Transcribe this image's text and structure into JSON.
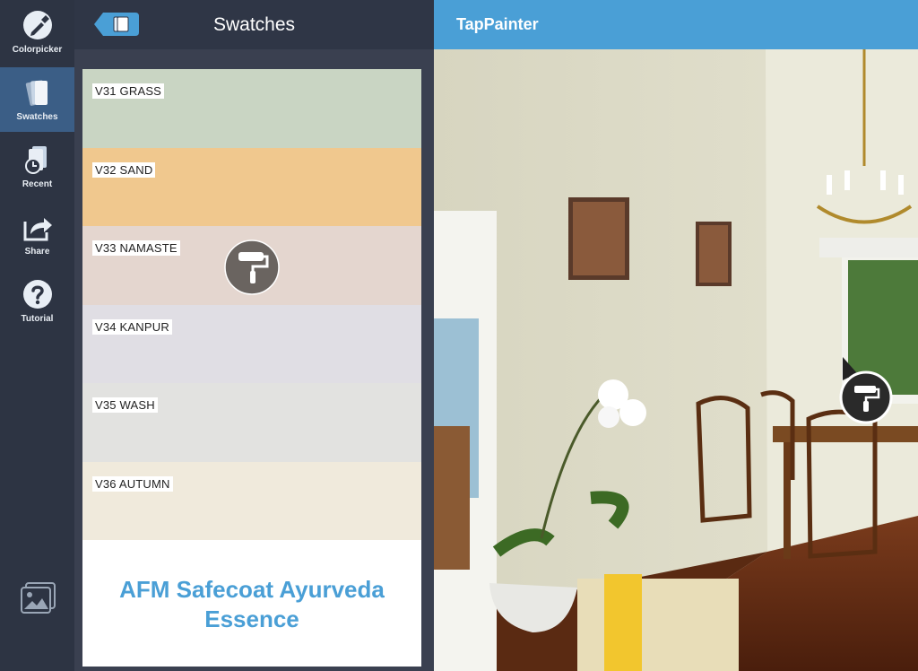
{
  "nav": {
    "items": [
      {
        "label": "Colorpicker",
        "icon": "eyedropper-icon"
      },
      {
        "label": "Swatches",
        "icon": "swatches-icon",
        "active": true
      },
      {
        "label": "Recent",
        "icon": "recent-icon"
      },
      {
        "label": "Share",
        "icon": "share-icon"
      },
      {
        "label": "Tutorial",
        "icon": "help-icon"
      }
    ],
    "gallery_icon": "gallery-icon"
  },
  "swatches_panel": {
    "title": "Swatches",
    "back_icon": "back-icon",
    "swatches": [
      {
        "label": "V31 GRASS",
        "color": "#c9d5c3"
      },
      {
        "label": "V32 SAND",
        "color": "#f0c88e"
      },
      {
        "label": "V33 NAMASTE",
        "color": "#e4d6cf"
      },
      {
        "label": "V34 KANPUR",
        "color": "#e0dee4"
      },
      {
        "label": "V35 WASH",
        "color": "#e2e2e0"
      },
      {
        "label": "V36 AUTUMN",
        "color": "#f0eadc"
      }
    ],
    "brand_line1": "AFM Safecoat Ayurveda",
    "brand_line2": "Essence",
    "brand_color": "#4a9fd6"
  },
  "tappainter": {
    "title": "TapPainter",
    "accent": "#4a9fd6"
  }
}
